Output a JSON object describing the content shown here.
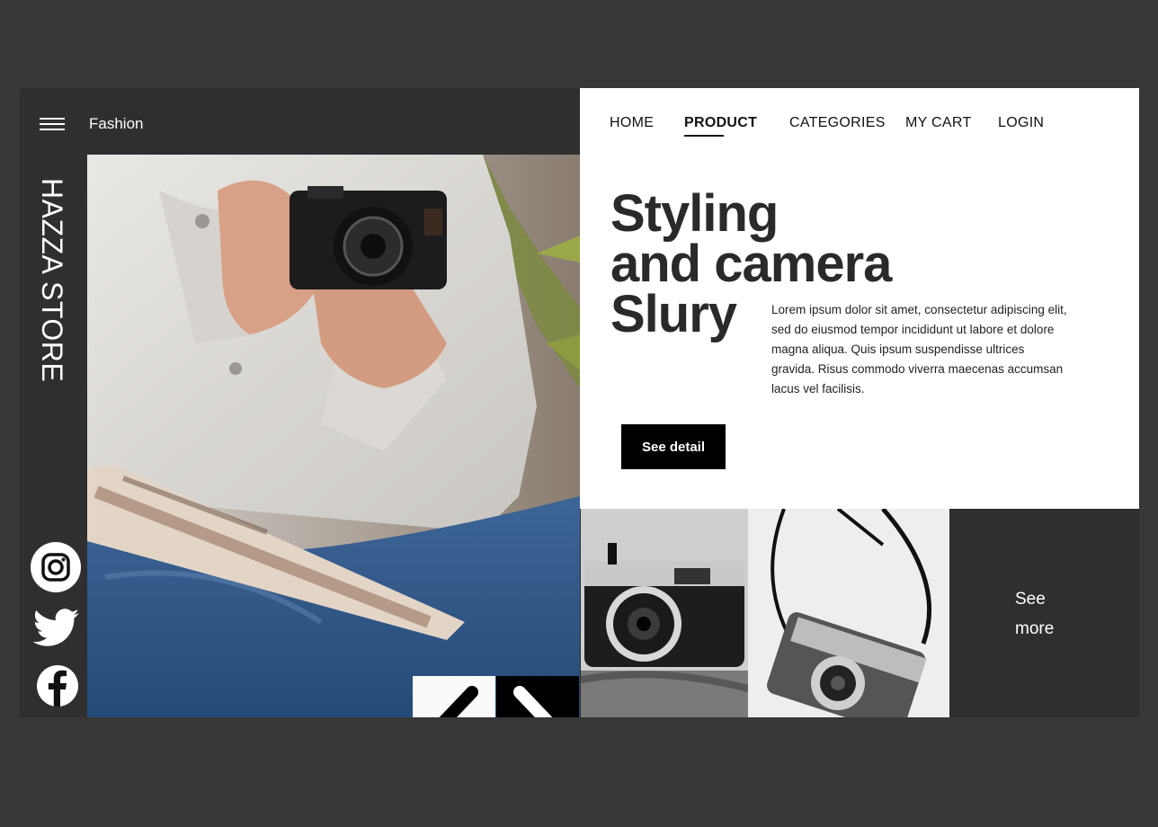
{
  "brand": {
    "menu_icon": "hamburger-icon",
    "label": "Fashion",
    "store_name": "HAZZA STORE"
  },
  "nav": {
    "items": [
      "HOME",
      "PRODUCT",
      "CATEGORIES",
      "MY CART",
      "LOGIN"
    ],
    "active": "PRODUCT"
  },
  "hero": {
    "headline": [
      "Styling",
      "and camera",
      "Slury"
    ],
    "description": "Lorem ipsum dolor sit amet, consectetur adipiscing elit, sed do eiusmod tempor incididunt ut labore et dolore magna aliqua. Quis ipsum suspendisse ultrices gravida. Risus commodo viverra maecenas accumsan lacus vel facilisis.",
    "cta_label": "See detail"
  },
  "social": [
    "instagram-icon",
    "twitter-icon",
    "facebook-icon"
  ],
  "carousel": {
    "prev_icon": "chevron-left-icon",
    "next_icon": "chevron-right-icon"
  },
  "gallery": {
    "see_more_label": "See more"
  },
  "colors": {
    "background": "#373737",
    "frame": "#2f2f2f",
    "panel": "#ffffff",
    "accent": "#000000"
  }
}
